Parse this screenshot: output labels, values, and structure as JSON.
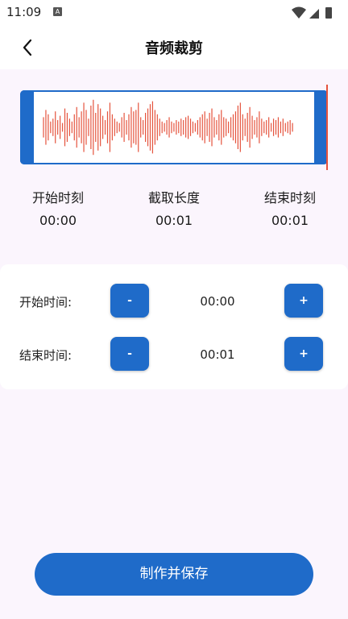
{
  "status_bar": {
    "time": "11:09",
    "notification_icon": "a-icon",
    "icons": [
      "wifi-icon",
      "signal-icon",
      "battery-icon"
    ]
  },
  "header": {
    "title": "音频裁剪",
    "back_icon": "chevron-left-icon"
  },
  "trim_info": {
    "start_label": "开始时刻",
    "start_value": "00:00",
    "length_label": "截取长度",
    "length_value": "00:01",
    "end_label": "结束时刻",
    "end_value": "00:01"
  },
  "controls": {
    "start_label": "开始时间:",
    "start_value": "00:00",
    "end_label": "结束时间:",
    "end_value": "00:01",
    "minus": "-",
    "plus": "+"
  },
  "save_button": "制作并保存",
  "colors": {
    "primary": "#1f6bc9",
    "waveform": "#e5533d",
    "background": "#fbf5fd"
  }
}
